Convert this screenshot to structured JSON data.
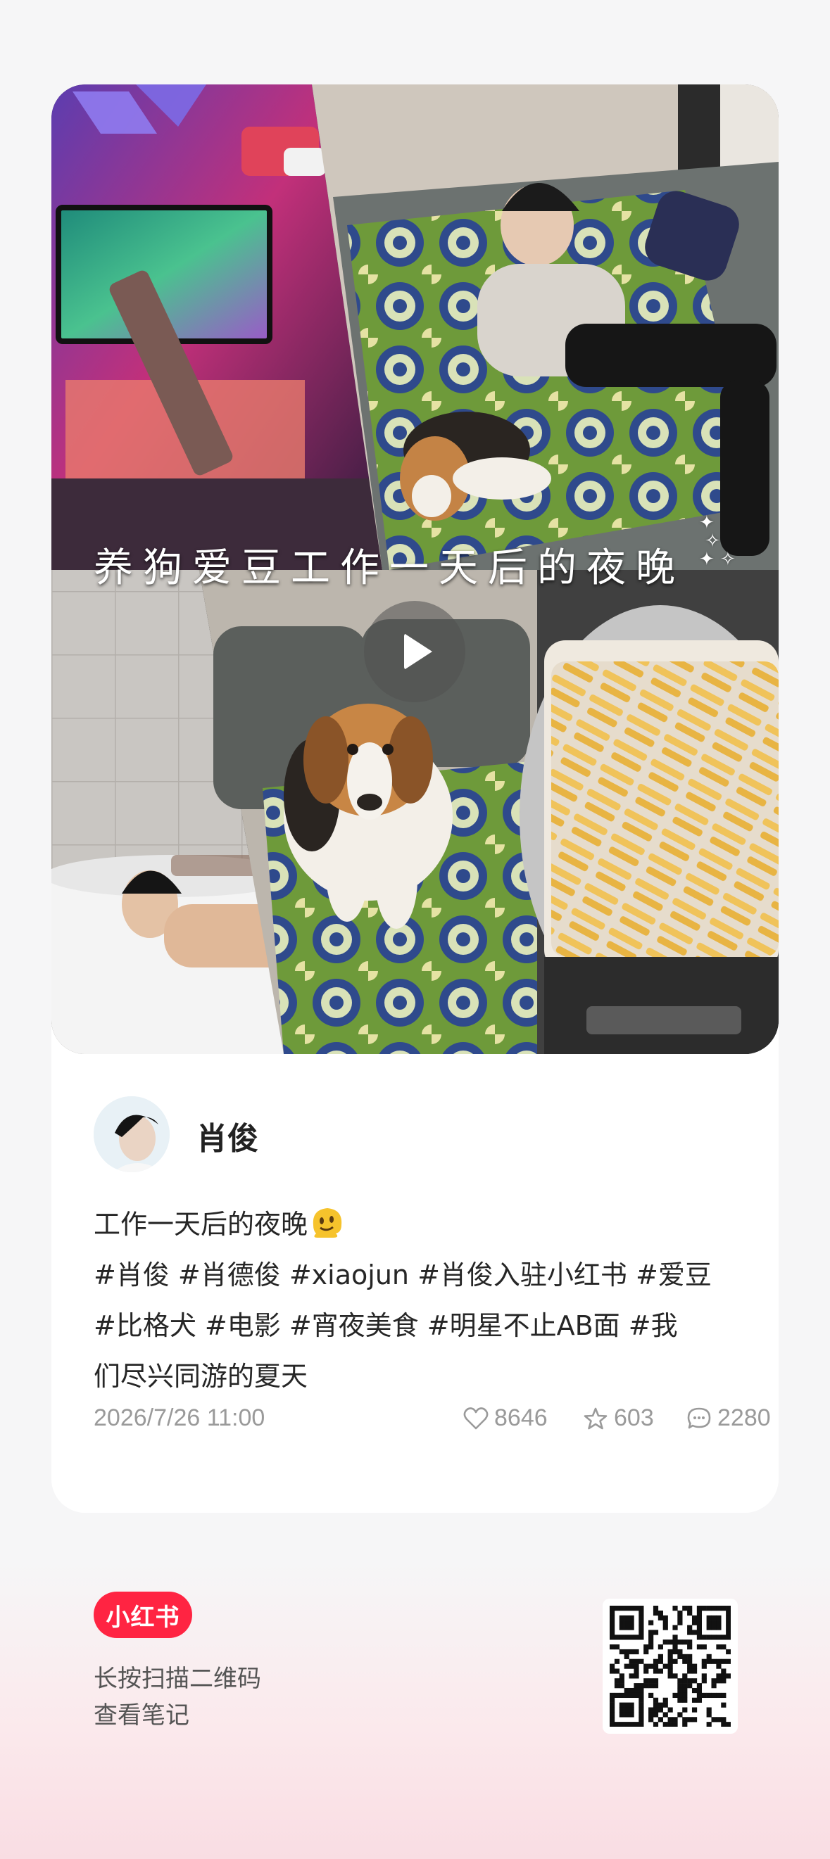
{
  "post": {
    "media_caption": "养狗爱豆工作一天后的夜晚",
    "author": {
      "name": "肖俊"
    },
    "body_lines": [
      "工作一天后的夜晚",
      "#肖俊 #肖德俊 #xiaojun #肖俊入驻小红书 #爱豆",
      "#比格犬 #电影 #宵夜美食  #明星不止AB面  #我",
      "们尽兴同游的夏天"
    ],
    "date": "2026/7/26 11:00",
    "stats": {
      "likes": "8646",
      "collects": "603",
      "comments": "2280"
    }
  },
  "footer": {
    "brand": "小红书",
    "scan_hint_line1": "长按扫描二维码",
    "scan_hint_line2": "查看笔记"
  },
  "icons": {
    "play": "play-icon",
    "like": "heart-icon",
    "collect": "star-icon",
    "comment": "comment-bubble-icon",
    "emoji": "melting-face-emoji"
  },
  "colors": {
    "brand": "#ff2442",
    "text": "#262626",
    "meta": "#9a9a9a"
  }
}
